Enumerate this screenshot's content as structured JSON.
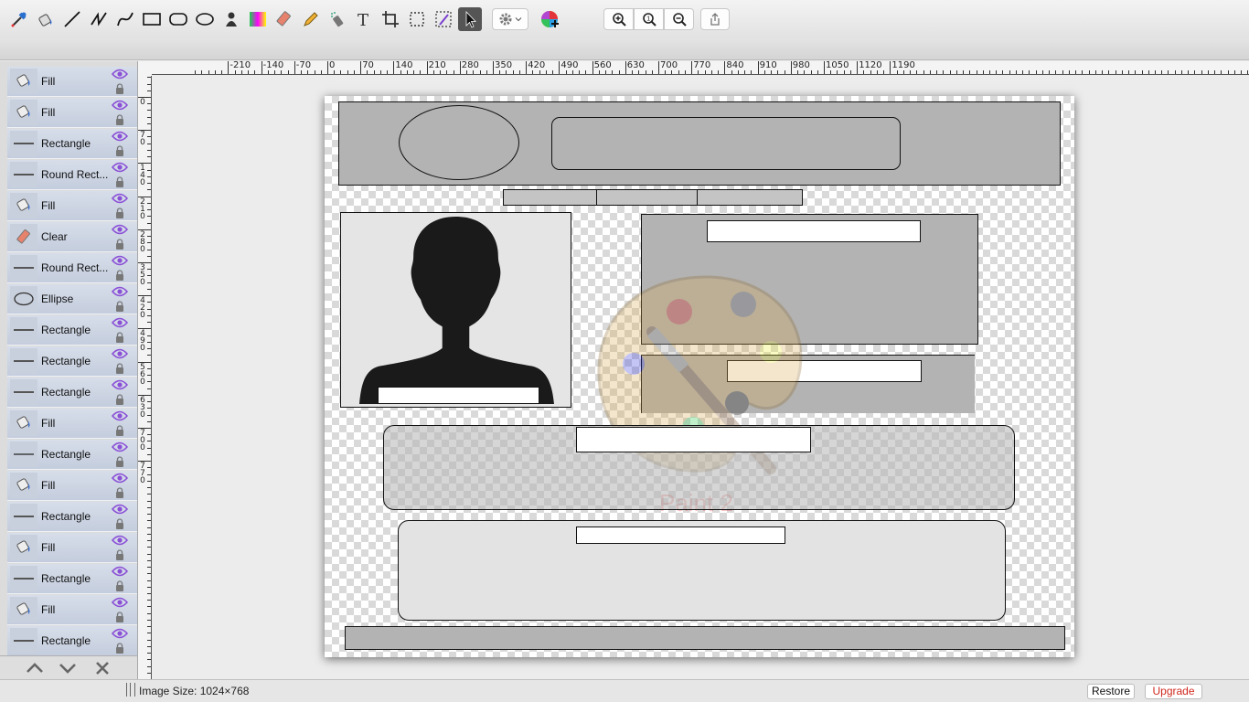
{
  "toolbar": {
    "tools": [
      {
        "name": "eyedropper-tool-icon"
      },
      {
        "name": "fill-tool-icon"
      },
      {
        "name": "line-tool-icon"
      },
      {
        "name": "bezier-tool-icon"
      },
      {
        "name": "curve-tool-icon"
      },
      {
        "name": "rectangle-tool-icon"
      },
      {
        "name": "rounded-rectangle-tool-icon"
      },
      {
        "name": "ellipse-tool-icon"
      },
      {
        "name": "stamp-tool-icon"
      },
      {
        "name": "gradient-tool-icon"
      },
      {
        "name": "eraser-tool-icon"
      },
      {
        "name": "pencil-tool-icon"
      },
      {
        "name": "spray-tool-icon"
      },
      {
        "name": "text-tool-icon"
      },
      {
        "name": "crop-tool-icon"
      },
      {
        "name": "rect-select-tool-icon"
      },
      {
        "name": "magic-select-tool-icon"
      },
      {
        "name": "pointer-tool-icon",
        "active": true
      }
    ],
    "zoom_in": "zoom-in-icon",
    "zoom_actual": "zoom-actual-icon",
    "zoom_out": "zoom-out-icon",
    "share": "share-icon",
    "settings": "gear-icon",
    "color_picker": "color-wheel-icon"
  },
  "layers": [
    {
      "label": "Fill",
      "type": "fill"
    },
    {
      "label": "Fill",
      "type": "fill"
    },
    {
      "label": "Rectangle",
      "type": "line"
    },
    {
      "label": "Round Rect...",
      "type": "line"
    },
    {
      "label": "Fill",
      "type": "fill"
    },
    {
      "label": "Clear",
      "type": "eraser"
    },
    {
      "label": "Round Rect...",
      "type": "line"
    },
    {
      "label": "Ellipse",
      "type": "ellipse"
    },
    {
      "label": "Rectangle",
      "type": "line"
    },
    {
      "label": "Rectangle",
      "type": "line"
    },
    {
      "label": "Rectangle",
      "type": "line"
    },
    {
      "label": "Fill",
      "type": "fill"
    },
    {
      "label": "Rectangle",
      "type": "thinline"
    },
    {
      "label": "Fill",
      "type": "fill"
    },
    {
      "label": "Rectangle",
      "type": "line"
    },
    {
      "label": "Fill",
      "type": "fill"
    },
    {
      "label": "Rectangle",
      "type": "line"
    },
    {
      "label": "Fill",
      "type": "fill"
    },
    {
      "label": "Rectangle",
      "type": "line"
    }
  ],
  "layer_controls": {
    "up": "chevron-up-icon",
    "down": "chevron-down-icon",
    "delete": "close-icon"
  },
  "ruler": {
    "h_labels": [
      "-210",
      "-140",
      "-70",
      "0",
      "70",
      "140",
      "210",
      "280",
      "350",
      "420",
      "490",
      "560",
      "630",
      "700",
      "770",
      "840",
      "910",
      "980",
      "1050",
      "1120",
      "1190"
    ],
    "v_labels": [
      "0",
      "70",
      "140",
      "210",
      "280",
      "350",
      "420",
      "490",
      "560",
      "630",
      "700",
      "770"
    ]
  },
  "watermark": {
    "text": "Paint 2"
  },
  "status": {
    "image_size": "Image Size: 1024×768",
    "restore_label": "Restore",
    "upgrade_label": "Upgrade"
  },
  "colors": {
    "accent": "#8a4fd6",
    "upgrade": "#d0281e",
    "shape_fill": "#b3b3b3"
  }
}
